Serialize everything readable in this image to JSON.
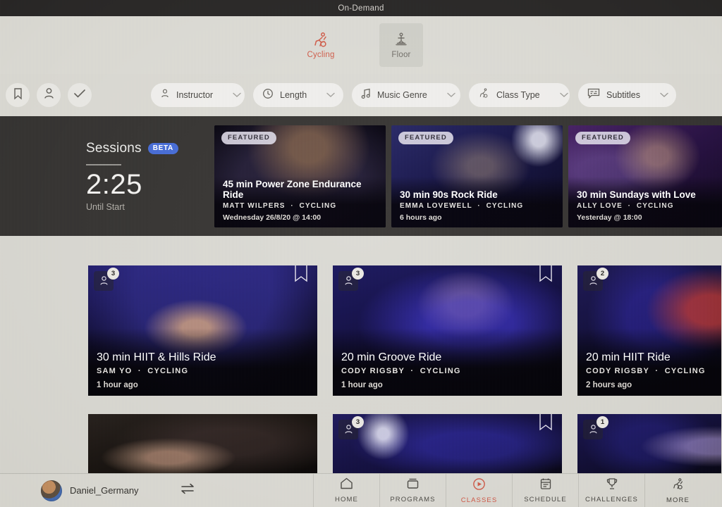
{
  "topbar": {
    "title": "On-Demand"
  },
  "discipline_tabs": [
    {
      "label": "Cycling",
      "icon": "cycling-icon",
      "active": true
    },
    {
      "label": "Floor",
      "icon": "floor-icon",
      "active": false
    }
  ],
  "filter_bar": {
    "round_buttons": [
      {
        "icon": "bookmark-icon",
        "name": "bookmarked-filter"
      },
      {
        "icon": "person-icon",
        "name": "instructor-filter"
      },
      {
        "icon": "check-icon",
        "name": "completed-filter"
      }
    ],
    "dropdowns": [
      {
        "label": "Instructor",
        "icon": "person-icon"
      },
      {
        "label": "Length",
        "icon": "clock-icon"
      },
      {
        "label": "Music Genre",
        "icon": "music-note-icon"
      },
      {
        "label": "Class Type",
        "icon": "cycling-icon"
      },
      {
        "label": "Subtitles",
        "icon": "subtitles-icon"
      }
    ],
    "edge_pill": {
      "icon": "equipment-icon"
    }
  },
  "sessions": {
    "title": "Sessions",
    "badge": "BETA",
    "countdown": "2:25",
    "subtitle": "Until Start"
  },
  "featured": [
    {
      "tag": "FEATURED",
      "title": "45 min Power Zone Endurance Ride",
      "instructor": "MATT WILPERS",
      "discipline": "CYCLING",
      "time": "Wednesday 26/8/20 @ 14:00"
    },
    {
      "tag": "FEATURED",
      "title": "30 min 90s Rock Ride",
      "instructor": "EMMA LOVEWELL",
      "discipline": "CYCLING",
      "time": "6 hours ago"
    },
    {
      "tag": "FEATURED",
      "title": "30 min Sundays with Love",
      "instructor": "ALLY LOVE",
      "discipline": "CYCLING",
      "time": "Yesterday @ 18:00"
    }
  ],
  "classes_row1": [
    {
      "title": "30 min HIIT & Hills Ride",
      "instructor": "SAM YO",
      "discipline": "CYCLING",
      "time": "1 hour ago",
      "count": "3",
      "bookmarked": true
    },
    {
      "title": "20 min Groove Ride",
      "instructor": "CODY RIGSBY",
      "discipline": "CYCLING",
      "time": "1 hour ago",
      "count": "3",
      "bookmarked": true
    },
    {
      "title": "20 min HIIT Ride",
      "instructor": "CODY RIGSBY",
      "discipline": "CYCLING",
      "time": "2 hours ago",
      "count": "2",
      "bookmarked": false
    }
  ],
  "classes_row2": [
    {
      "count": "",
      "bookmarked": false
    },
    {
      "count": "3",
      "bookmarked": true
    },
    {
      "count": "1",
      "bookmarked": false
    }
  ],
  "bottom_nav": {
    "username": "Daniel_Germany",
    "swap_icon": "swap-arrows-icon",
    "items": [
      {
        "label": "HOME",
        "icon": "home-icon",
        "active": false
      },
      {
        "label": "PROGRAMS",
        "icon": "programs-icon",
        "active": false
      },
      {
        "label": "CLASSES",
        "icon": "play-circle-icon",
        "active": true
      },
      {
        "label": "SCHEDULE",
        "icon": "calendar-icon",
        "active": false
      },
      {
        "label": "CHALLENGES",
        "icon": "trophy-icon",
        "active": false
      },
      {
        "label": "MORE",
        "icon": "cycling-icon",
        "active": false
      }
    ]
  },
  "colors": {
    "accent": "#d0614f",
    "background": "#d9d8d2",
    "band": "#3a3836",
    "topbar": "#2e2c2b",
    "beta": "#4a6fd6"
  }
}
